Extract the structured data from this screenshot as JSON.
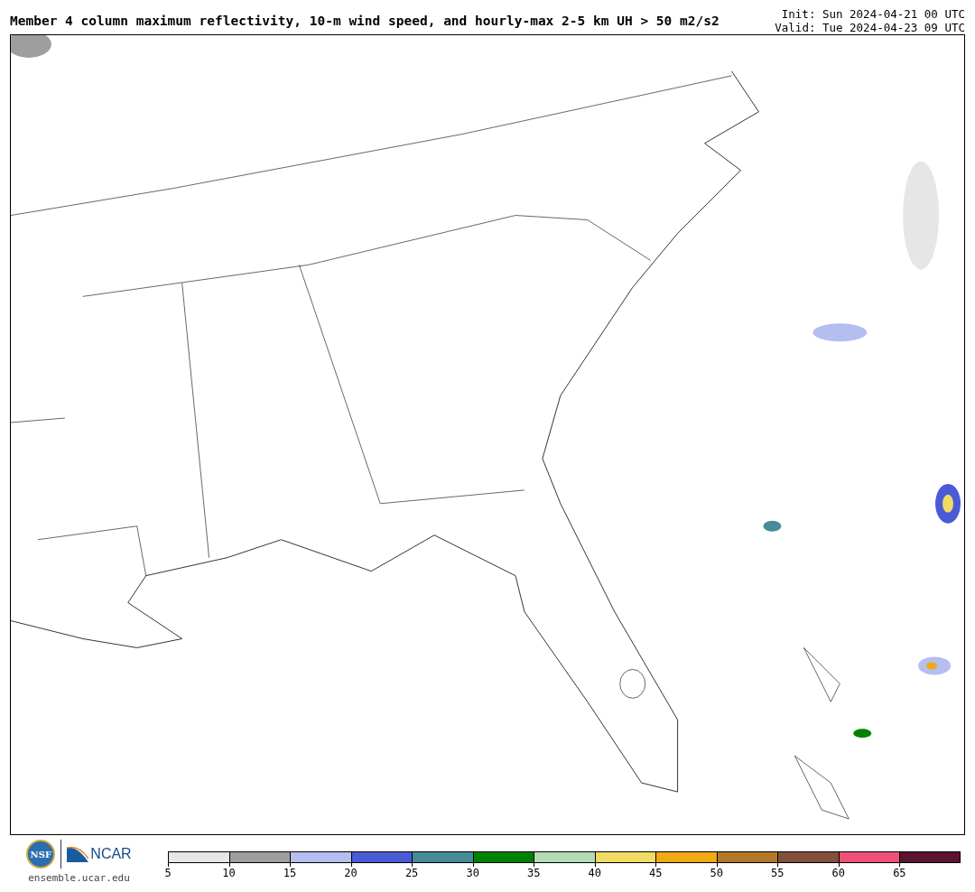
{
  "title": "Member 4 column maximum reflectivity, 10-m wind speed, and hourly-max 2-5 km UH > 50 m2/s2",
  "init": "Init: Sun 2024-04-21 00 UTC",
  "valid": "Valid: Tue 2024-04-23 09 UTC",
  "logos": {
    "nsf": "NSF",
    "ncar": "NCAR",
    "site": "ensemble.ucar.edu"
  },
  "colorbar": [
    {
      "tick": "5",
      "color": "#e6e6e6"
    },
    {
      "tick": "10",
      "color": "#9e9e9e"
    },
    {
      "tick": "15",
      "color": "#b4bef0"
    },
    {
      "tick": "20",
      "color": "#4b5ad7"
    },
    {
      "tick": "25",
      "color": "#448c96"
    },
    {
      "tick": "30",
      "color": "#008200"
    },
    {
      "tick": "35",
      "color": "#b4dcb4"
    },
    {
      "tick": "40",
      "color": "#f0dc64"
    },
    {
      "tick": "45",
      "color": "#f0aa14"
    },
    {
      "tick": "50",
      "color": "#b47828"
    },
    {
      "tick": "55",
      "color": "#82503c"
    },
    {
      "tick": "60",
      "color": "#f05078"
    },
    {
      "tick": "65",
      "color": "#5a1432"
    }
  ]
}
